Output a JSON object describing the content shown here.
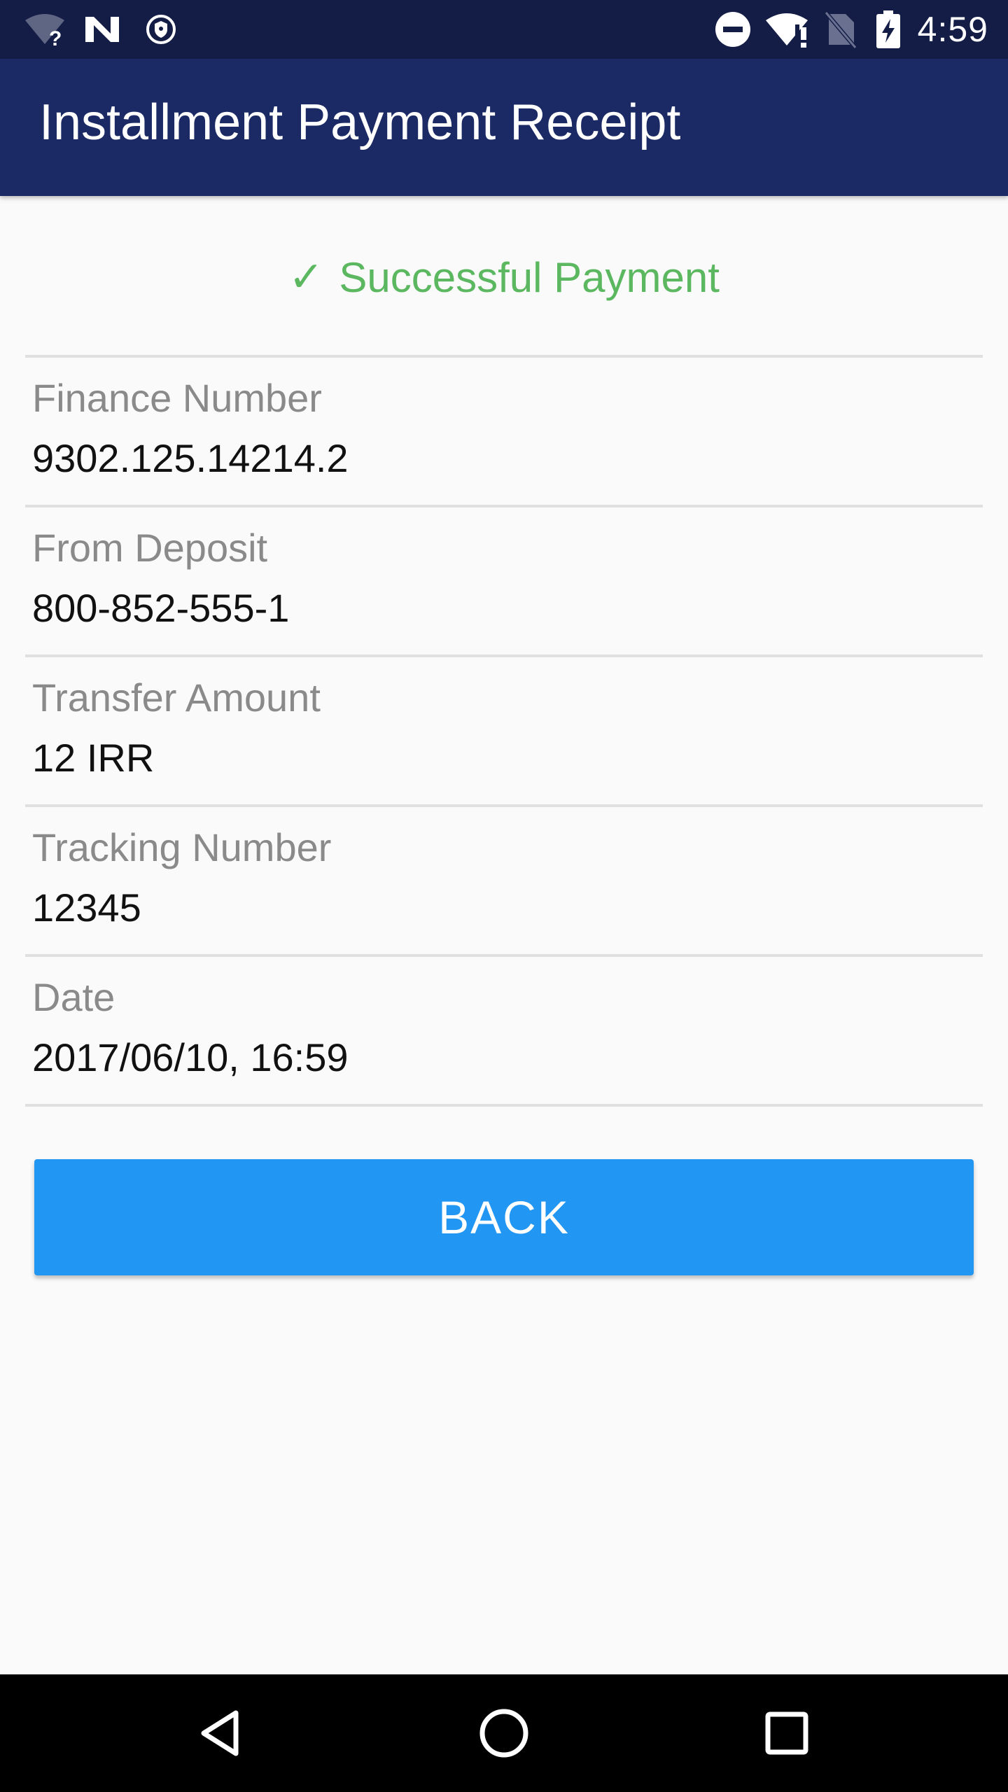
{
  "status_bar": {
    "time": "4:59",
    "left_icons": [
      "wifi-unknown-icon",
      "n-logo-icon",
      "shield-icon"
    ],
    "right_icons": [
      "do-not-disturb-icon",
      "wifi-alert-icon",
      "no-sim-icon",
      "battery-charging-icon"
    ]
  },
  "app_bar": {
    "title": "Installment Payment Receipt",
    "background": "#1b2a64"
  },
  "status_message": {
    "icon": "checkmark-icon",
    "check_glyph": "✓",
    "text": "Successful Payment",
    "color": "#5cb860"
  },
  "receipt": [
    {
      "label": "Finance Number",
      "value": "9302.125.14214.2"
    },
    {
      "label": "From Deposit",
      "value": "800-852-555-1"
    },
    {
      "label": "Transfer Amount",
      "value": "12 IRR"
    },
    {
      "label": "Tracking Number",
      "value": "12345"
    },
    {
      "label": "Date",
      "value": "2017/06/10, 16:59"
    }
  ],
  "actions": {
    "back_label": "BACK",
    "back_color": "#2196f3"
  },
  "nav_bar": {
    "buttons": [
      "back-triangle-icon",
      "home-circle-icon",
      "recents-square-icon"
    ]
  }
}
